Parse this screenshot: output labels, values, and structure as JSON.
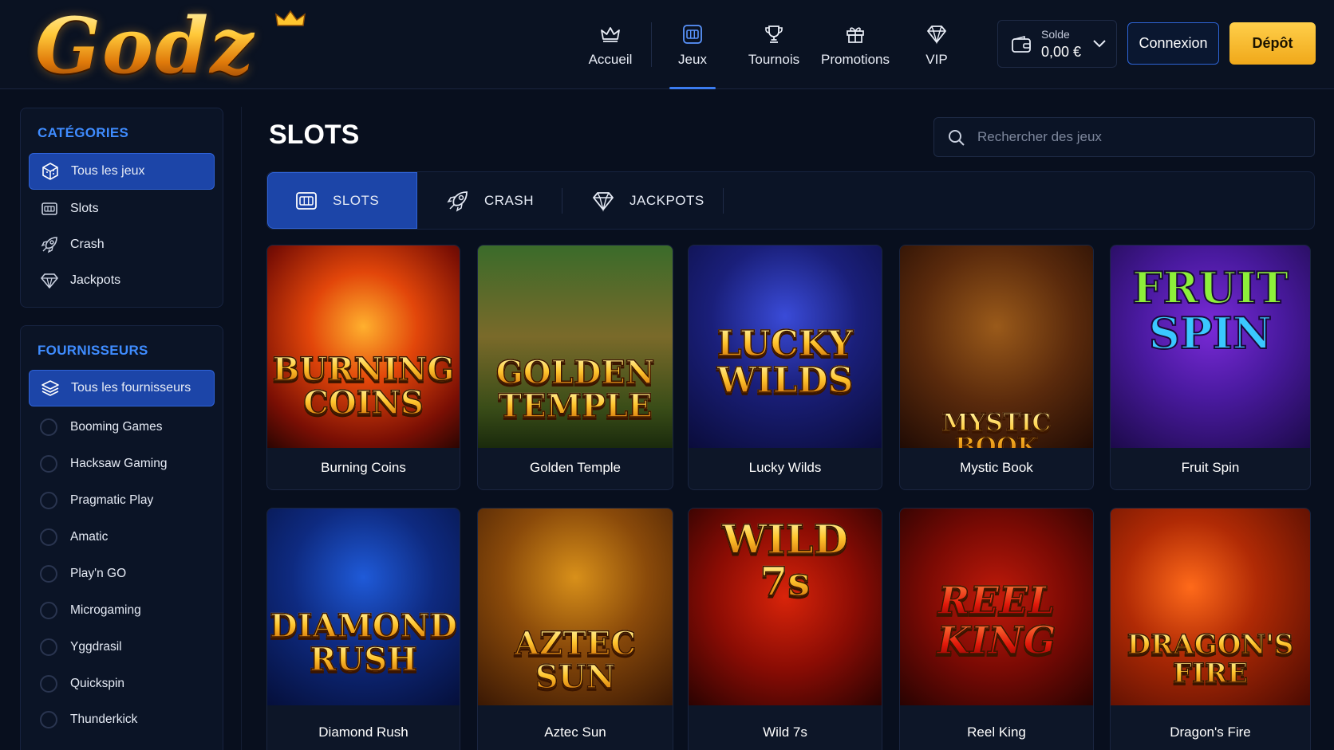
{
  "brand": {
    "logo_text": "Godz"
  },
  "nav": {
    "items": [
      {
        "label": "Accueil",
        "icon": "crown-icon"
      },
      {
        "label": "Jeux",
        "icon": "slot-machine-icon",
        "active": true
      },
      {
        "label": "Tournois",
        "icon": "trophy-icon"
      },
      {
        "label": "Promotions",
        "icon": "gift-icon"
      },
      {
        "label": "VIP",
        "icon": "diamond-icon"
      }
    ]
  },
  "balance": {
    "label": "Solde",
    "value": "0,00 €"
  },
  "auth": {
    "login_label": "Connexion",
    "deposit_label": "Dépôt"
  },
  "sidebar": {
    "categories_title": "CATÉGORIES",
    "categories": [
      {
        "label": "Tous les jeux",
        "icon": "cube-icon",
        "active": true
      },
      {
        "label": "Slots",
        "icon": "slot-machine-icon"
      },
      {
        "label": "Crash",
        "icon": "rocket-icon"
      },
      {
        "label": "Jackpots",
        "icon": "diamond-icon"
      }
    ],
    "providers_title": "FOURNISSEURS",
    "providers_all": {
      "label": "Tous les fournisseurs",
      "icon": "layers-icon",
      "active": true
    },
    "providers": [
      {
        "label": "Booming Games"
      },
      {
        "label": "Hacksaw Gaming"
      },
      {
        "label": "Pragmatic Play"
      },
      {
        "label": "Amatic"
      },
      {
        "label": "Play'n GO"
      },
      {
        "label": "Microgaming"
      },
      {
        "label": "Yggdrasil"
      },
      {
        "label": "Quickspin"
      },
      {
        "label": "Thunderkick"
      }
    ]
  },
  "main": {
    "title": "SLOTS",
    "search": {
      "placeholder": "Rechercher des jeux",
      "value": ""
    },
    "tabs": [
      {
        "label": "SLOTS",
        "icon": "slot-machine-icon",
        "active": true
      },
      {
        "label": "CRASH",
        "icon": "rocket-icon"
      },
      {
        "label": "JACKPOTS",
        "icon": "diamond-icon"
      }
    ],
    "games": [
      {
        "name": "Burning Coins",
        "art_lines": [
          "BURNING",
          "COINS"
        ]
      },
      {
        "name": "Golden Temple",
        "art_lines": [
          "GOLDEN",
          "TEMPLE"
        ]
      },
      {
        "name": "Lucky Wilds",
        "art_lines": [
          "LUCKY",
          "WILDS"
        ]
      },
      {
        "name": "Mystic Book",
        "art_lines": [
          "MYSTIC BOOK"
        ]
      },
      {
        "name": "Fruit Spin",
        "art_lines": [
          "FRUIT",
          "SPIN"
        ]
      },
      {
        "name": "Diamond Rush",
        "art_lines": [
          "DIAMOND",
          "RUSH"
        ]
      },
      {
        "name": "Aztec Sun",
        "art_lines": [
          "AZTEC",
          "SUN"
        ]
      },
      {
        "name": "Wild 7s",
        "art_lines": [
          "WILD",
          "7s"
        ]
      },
      {
        "name": "Reel King",
        "art_lines": [
          "REEL",
          "KING"
        ]
      },
      {
        "name": "Dragon's Fire",
        "art_lines": [
          "DRAGON'S",
          "FIRE"
        ]
      }
    ]
  },
  "colors": {
    "background": "#080f1e",
    "accent_blue": "#1c45a8",
    "title_blue": "#3f8cff",
    "deposit_gold": "#f0a81a"
  }
}
